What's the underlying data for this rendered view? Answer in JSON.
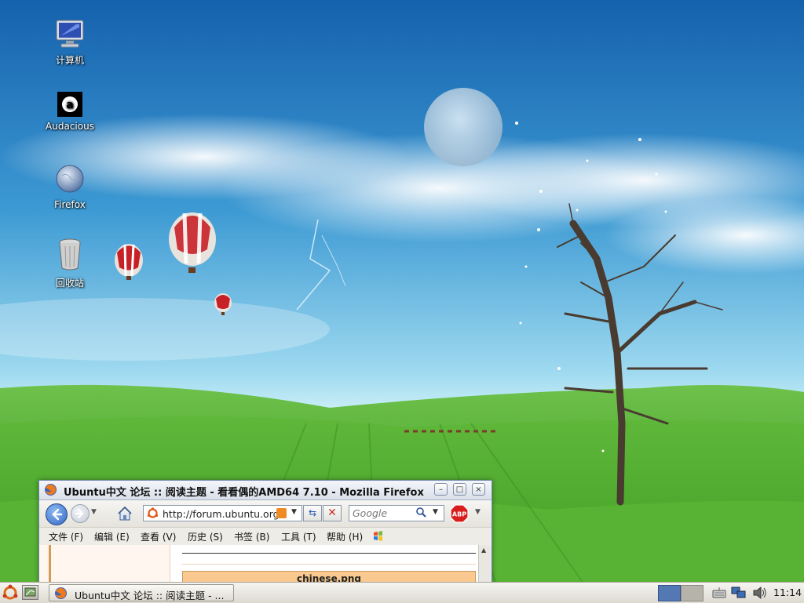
{
  "desktop": {
    "icons": [
      {
        "label": "计算机",
        "icon": "computer-icon"
      },
      {
        "label": "Audacious",
        "icon": "audacious-icon"
      },
      {
        "label": "Firefox",
        "icon": "firefox-globe-icon"
      },
      {
        "label": "回收站",
        "icon": "trash-icon"
      }
    ]
  },
  "firefox": {
    "title": "Ubuntu中文 论坛 :: 阅读主题 - 看看偶的AMD64 7.10 - Mozilla Firefox",
    "window_buttons": {
      "minimize": "–",
      "maximize": "□",
      "close": "×"
    },
    "url": "http://forum.ubuntu.org",
    "search_placeholder": "Google",
    "menu": [
      {
        "label": "文件 (F)"
      },
      {
        "label": "编辑 (E)"
      },
      {
        "label": "查看 (V)"
      },
      {
        "label": "历史 (S)"
      },
      {
        "label": "书签 (B)"
      },
      {
        "label": "工具 (T)"
      },
      {
        "label": "帮助 (H)"
      }
    ],
    "content": {
      "attachment_label": "chinese.png"
    },
    "abp_label": "ABP"
  },
  "panel": {
    "task_label": "Ubuntu中文 论坛 :: 阅读主题 - ...",
    "clock": "11:14"
  },
  "colors": {
    "panel": "#dcd9d0",
    "sky": "#1b6db5",
    "grass": "#4ea52a",
    "workspace_active": "#5378b4"
  }
}
